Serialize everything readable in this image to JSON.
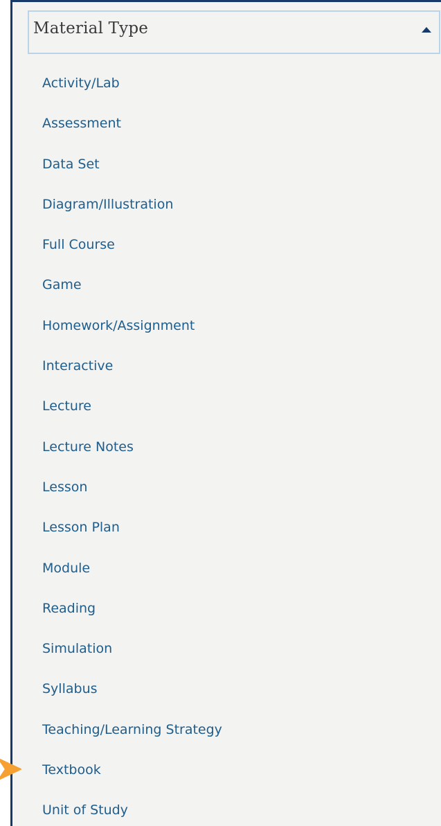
{
  "filter_panel": {
    "title": "Material Type",
    "expanded": true,
    "caret_icon": "caret-up-icon",
    "items": [
      {
        "label": "Activity/Lab"
      },
      {
        "label": "Assessment"
      },
      {
        "label": "Data Set"
      },
      {
        "label": "Diagram/Illustration"
      },
      {
        "label": "Full Course"
      },
      {
        "label": "Game"
      },
      {
        "label": "Homework/Assignment"
      },
      {
        "label": "Interactive"
      },
      {
        "label": "Lecture"
      },
      {
        "label": "Lecture Notes"
      },
      {
        "label": "Lesson"
      },
      {
        "label": "Lesson Plan"
      },
      {
        "label": "Module"
      },
      {
        "label": "Reading"
      },
      {
        "label": "Simulation"
      },
      {
        "label": "Syllabus"
      },
      {
        "label": "Teaching/Learning Strategy"
      },
      {
        "label": "Textbook"
      },
      {
        "label": "Unit of Study"
      }
    ]
  },
  "annotation": {
    "icon": "pointer-arrow-icon",
    "color": "#f5a030",
    "points_to": "Textbook"
  },
  "colors": {
    "panel_border": "#173a6b",
    "panel_background": "#f3f3f2",
    "header_border": "#b9d3ea",
    "link": "#1e5d8c",
    "title": "#3a3a3a"
  }
}
